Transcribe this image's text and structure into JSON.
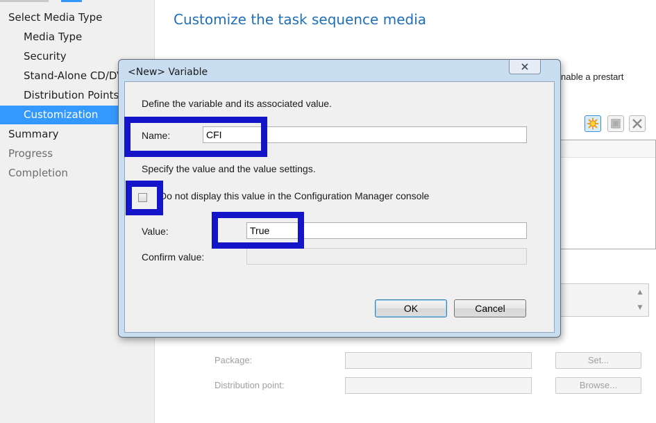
{
  "sidebar": {
    "items": [
      {
        "label": "Select Media Type",
        "state": "normal"
      },
      {
        "label": "Media Type",
        "state": "normal"
      },
      {
        "label": "Security",
        "state": "normal"
      },
      {
        "label": "Stand-Alone CD/DVD",
        "state": "normal"
      },
      {
        "label": "Distribution Points",
        "state": "normal"
      },
      {
        "label": "Customization",
        "state": "selected"
      },
      {
        "label": "Summary",
        "state": "normal"
      },
      {
        "label": "Progress",
        "state": "disabled"
      },
      {
        "label": "Completion",
        "state": "disabled"
      }
    ]
  },
  "main": {
    "title": "Customize the task sequence media",
    "description_tail": "nable a prestart",
    "toolbar": {
      "new_icon": "starburst-new-icon",
      "properties_icon": "properties-icon",
      "delete_icon": "delete-x-icon"
    },
    "package_label": "Package:",
    "package_value": "",
    "distribution_point_label": "Distribution point:",
    "distribution_point_value": "",
    "set_button": "Set...",
    "browse_button": "Browse..."
  },
  "dialog": {
    "title": "<New> Variable",
    "instruction": "Define the variable and its associated value.",
    "name_label": "Name:",
    "name_value": "CFI",
    "value_settings_text": "Specify the value and the value settings.",
    "checkbox_label": "Do not display this value in the Configuration Manager console",
    "checkbox_checked": false,
    "value_label": "Value:",
    "value_value": "True",
    "confirm_label": "Confirm value:",
    "confirm_value": "",
    "ok_button": "OK",
    "cancel_button": "Cancel"
  },
  "colors": {
    "highlight_box": "#1414c8",
    "selected_nav": "#3399ff",
    "title_blue": "#1f6fb8"
  }
}
